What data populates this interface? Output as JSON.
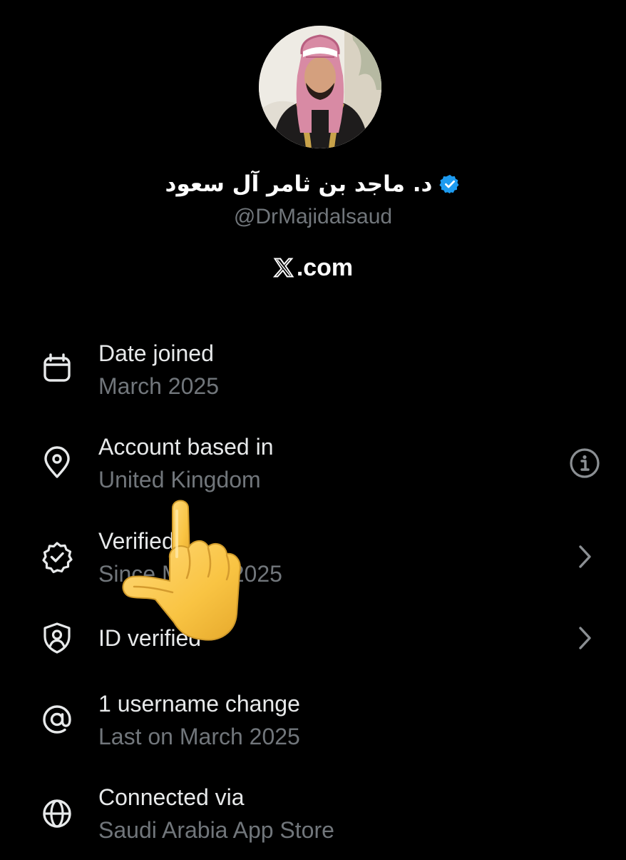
{
  "profile": {
    "display_name": "د. ماجد بن ثامر آل سعود",
    "handle": "@DrMajidalsaud",
    "site": ".com"
  },
  "colors": {
    "background": "#000000",
    "primary_text": "#e7e9ea",
    "secondary_text": "#71767b",
    "verified_blue": "#1d9bf0"
  },
  "rows": [
    {
      "icon": "calendar-icon",
      "title": "Date joined",
      "subtitle": "March 2025"
    },
    {
      "icon": "location-pin-icon",
      "title": "Account based in",
      "subtitle": "United Kingdom",
      "trailing": "info-icon"
    },
    {
      "icon": "verified-badge-icon",
      "title": "Verified",
      "subtitle": "Since March 2025",
      "trailing": "chevron-right-icon"
    },
    {
      "icon": "shield-user-icon",
      "title": "ID verified",
      "subtitle": "",
      "trailing": "chevron-right-icon"
    },
    {
      "icon": "at-sign-icon",
      "title": "1 username change",
      "subtitle": "Last on March 2025"
    },
    {
      "icon": "globe-icon",
      "title": "Connected via",
      "subtitle": "Saudi Arabia App Store"
    }
  ],
  "overlay": {
    "icon": "pointing-hand-emoji"
  }
}
